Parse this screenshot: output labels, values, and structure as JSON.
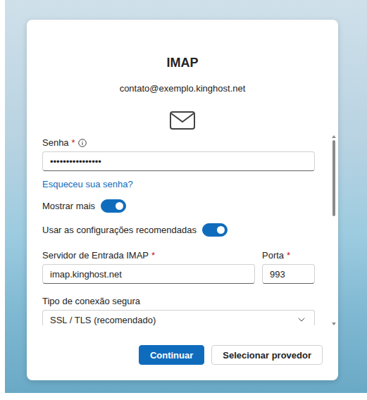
{
  "dialog": {
    "title": "IMAP",
    "account": "contato@exemplo.kinghost.net"
  },
  "password": {
    "label": "Senha",
    "required": "*",
    "value": "••••••••••••••••"
  },
  "forgot_link": "Esqueceu sua senha?",
  "toggles": [
    {
      "label": "Mostrar mais",
      "on": true
    },
    {
      "label": "Usar as configurações recomendadas",
      "on": true
    }
  ],
  "fields": [
    {
      "label": "Servidor de Entrada IMAP",
      "required": "*",
      "value": "imap.kinghost.net"
    },
    {
      "label": "Porta",
      "required": "*",
      "value": "993"
    }
  ],
  "connection": {
    "label": "Tipo de conexão segura",
    "value": "SSL / TLS (recomendado)"
  },
  "scrollbar": {
    "level": 0.42
  },
  "buttons": [
    {
      "label": "Continuar",
      "primary": true
    },
    {
      "label": "Selecionar provedor",
      "primary": false
    }
  ]
}
